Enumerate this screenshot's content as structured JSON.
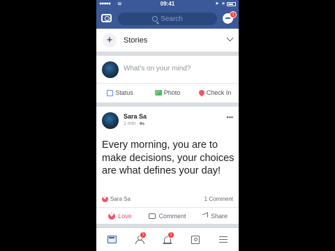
{
  "status_bar": {
    "signal": "●●●●●",
    "wifi": "≋",
    "time": "09:41",
    "location": "➤",
    "bluetooth": "∗"
  },
  "header": {
    "search_placeholder": "Search",
    "messenger_badge": "1"
  },
  "stories": {
    "plus": "+",
    "label": "Stories"
  },
  "composer": {
    "placeholder": "What's on your mind?",
    "actions": [
      {
        "label": "Status",
        "icon": "status-icon"
      },
      {
        "label": "Photo",
        "icon": "photo-icon"
      },
      {
        "label": "Check In",
        "icon": "location-pin-icon"
      }
    ]
  },
  "post": {
    "author": "Sara Sa",
    "time": "1 min",
    "separator": "·",
    "more": "•••",
    "text": "Every morning, you are to make decisions, your choices are what defines your day!",
    "reaction_name": "Sara Sa",
    "comment_count": "1 Comment",
    "actions": [
      {
        "label": "Love",
        "icon": "love-reaction-icon"
      },
      {
        "label": "Comment",
        "icon": "comment-icon"
      },
      {
        "label": "Share",
        "icon": "share-icon"
      }
    ]
  },
  "tabbar": {
    "friends_badge": "1",
    "notifications_badge": "1"
  },
  "colors": {
    "brand": "#3b5998",
    "love": "#f25268",
    "badge": "#fa3e3e"
  }
}
